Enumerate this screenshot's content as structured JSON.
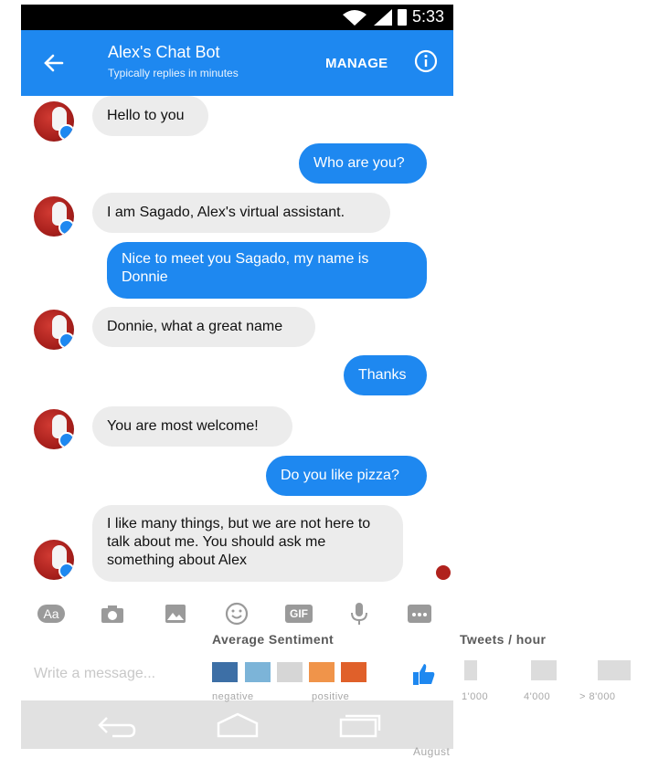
{
  "status_bar": {
    "time": "5:33"
  },
  "header": {
    "title": "Alex's Chat Bot",
    "subtitle": "Typically replies in minutes",
    "manage_label": "MANAGE",
    "back_icon": "arrow-left-icon",
    "info_icon": "info-icon"
  },
  "messages": [
    {
      "from": "bot",
      "text": "Hello to you"
    },
    {
      "from": "user",
      "text": "Who are you?"
    },
    {
      "from": "bot",
      "text": "I am Sagado, Alex's virtual assistant."
    },
    {
      "from": "user",
      "text": "Nice to meet you Sagado, my name is Donnie"
    },
    {
      "from": "bot",
      "text": "Donnie, what a great name"
    },
    {
      "from": "user",
      "text": "Thanks"
    },
    {
      "from": "bot",
      "text": "You are most welcome!"
    },
    {
      "from": "user",
      "text": "Do you like pizza?"
    },
    {
      "from": "bot",
      "text": "I like many things, but we are not here to talk about me. You should ask me something about Alex"
    }
  ],
  "composer": {
    "toolbar": [
      {
        "icon": "text-format-icon",
        "label": "Aa"
      },
      {
        "icon": "camera-icon"
      },
      {
        "icon": "image-icon"
      },
      {
        "icon": "emoji-icon"
      },
      {
        "icon": "gif-icon",
        "label": "GIF"
      },
      {
        "icon": "microphone-icon"
      },
      {
        "icon": "more-icon"
      }
    ],
    "placeholder": "Write a message...",
    "like_icon": "thumbs-up-icon"
  },
  "nav_bar": [
    "back-nav-icon",
    "home-nav-icon",
    "recent-apps-icon"
  ],
  "overlay_legend": {
    "sentiment_title": "Average Sentiment",
    "sentiment_low": "negative",
    "sentiment_high": "positive",
    "sentiment_colors": [
      "#3d6fa6",
      "#7cb4d8",
      "#d6d6d6",
      "#f0944a",
      "#e0602a"
    ],
    "tweets_title": "Tweets / hour",
    "tweets_levels": [
      "1'000",
      "4'000",
      "> 8'000"
    ],
    "footer": "August"
  },
  "colors": {
    "accent": "#1e88f0",
    "bot_bubble": "#ececec"
  }
}
